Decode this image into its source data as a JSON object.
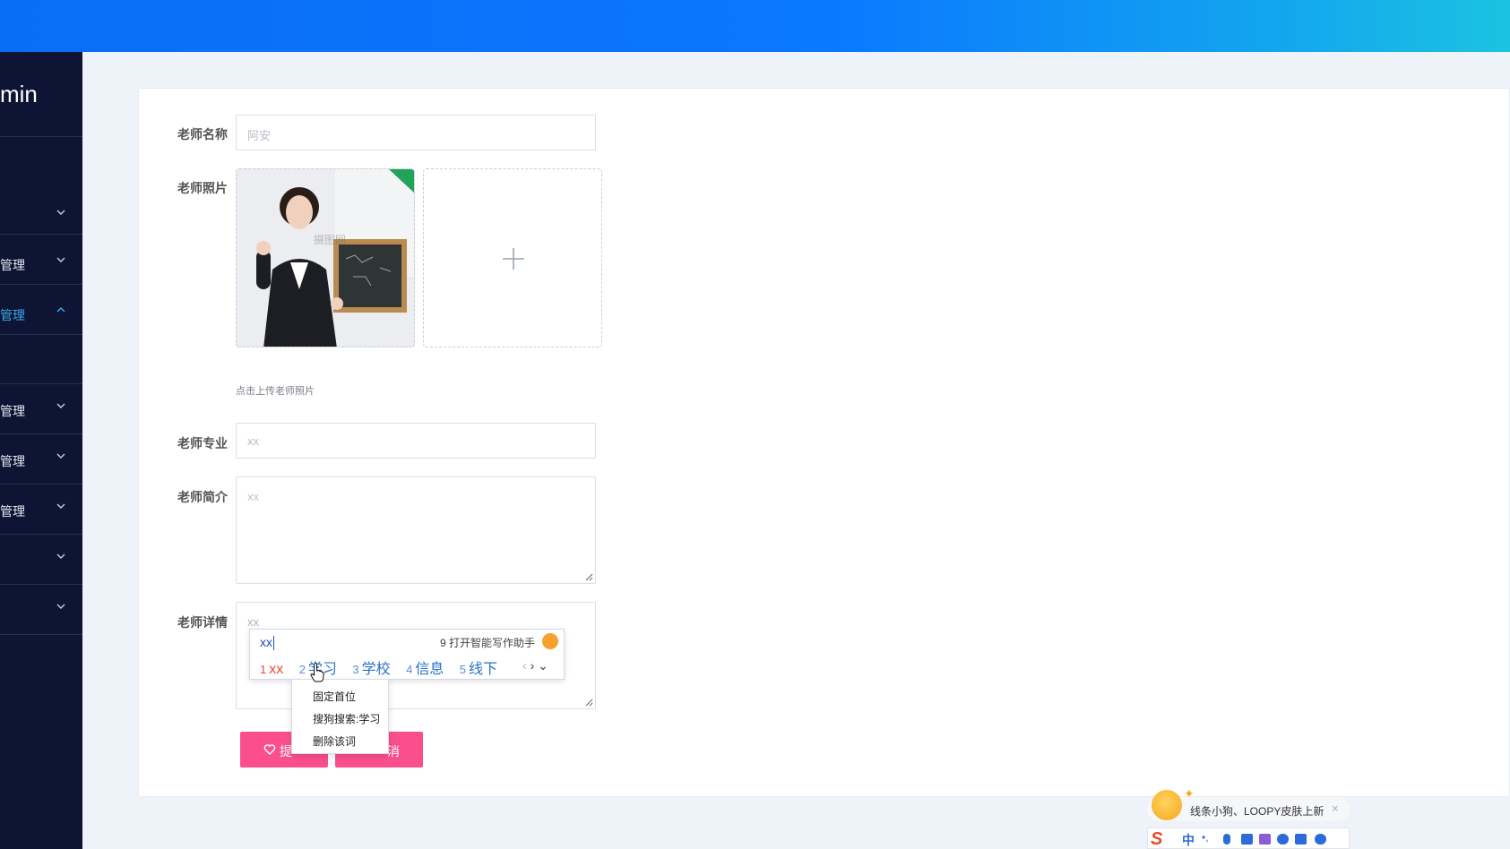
{
  "sidebar": {
    "brand": "min",
    "items": [
      {
        "label": "",
        "expanded": false
      },
      {
        "label": "管理",
        "expanded": false
      },
      {
        "label": "管理",
        "expanded": true,
        "active": true
      },
      {
        "label": "管理",
        "expanded": false
      },
      {
        "label": "管理",
        "expanded": false
      },
      {
        "label": "管理",
        "expanded": false
      },
      {
        "label": "",
        "expanded": false
      },
      {
        "label": "",
        "expanded": false
      }
    ]
  },
  "form": {
    "name_label": "老师名称",
    "name_placeholder": "阿安",
    "photo_label": "老师照片",
    "photo_hint": "点击上传老师照片",
    "major_label": "老师专业",
    "major_placeholder": "xx",
    "intro_label": "老师简介",
    "intro_placeholder": "xx",
    "detail_label": "老师详情",
    "detail_value": "xx"
  },
  "photo_watermark": "摄图网",
  "buttons": {
    "submit_label": "提",
    "cancel_label": "消"
  },
  "ime": {
    "composition": "xx",
    "assistant": "9 打开智能写作助手",
    "candidates": [
      {
        "num": "1",
        "text": "xx"
      },
      {
        "num": "2",
        "text": "学习"
      },
      {
        "num": "3",
        "text": "学校"
      },
      {
        "num": "4",
        "text": "信息"
      },
      {
        "num": "5",
        "text": "线下"
      }
    ],
    "context_menu": [
      "固定首位",
      "搜狗搜索:学习",
      "删除该词"
    ]
  },
  "notification": {
    "text": "线条小狗、LOOPY皮肤上新",
    "close": "×"
  },
  "imebar": {
    "lang": "中"
  },
  "colors": {
    "accent": "#0a78ff",
    "sidebar_bg": "#0e1534",
    "button": "#fb4f8c"
  }
}
